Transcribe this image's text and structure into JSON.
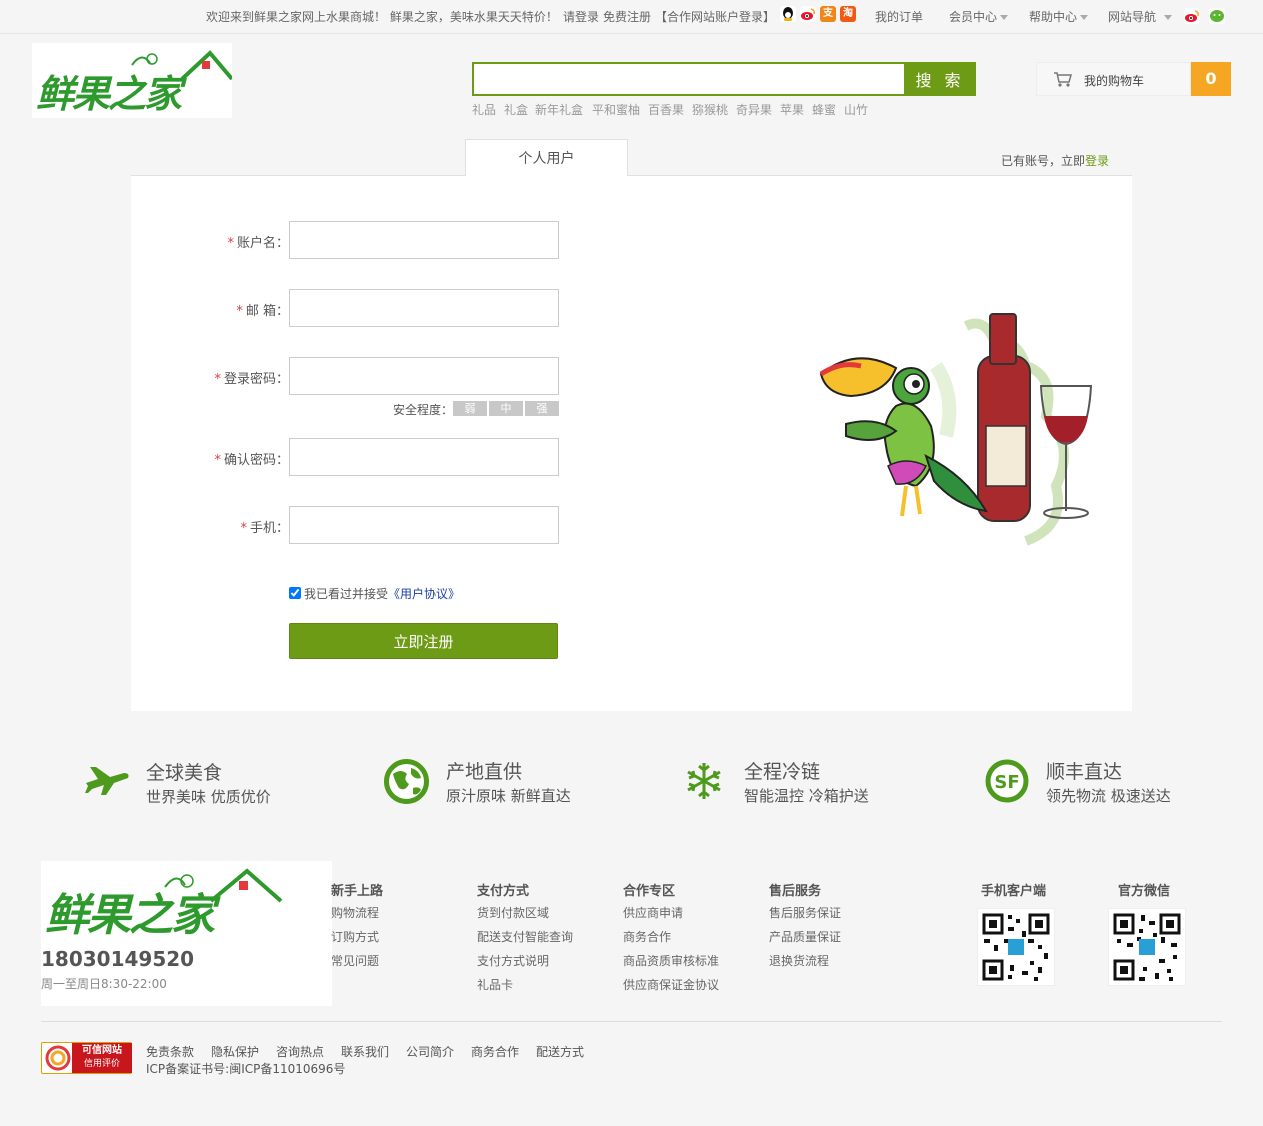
{
  "topbar": {
    "welcome": "欢迎来到鲜果之家网上水果商城！ 鲜果之家，美味水果天天特价！",
    "login": "请登录",
    "register": "免费注册",
    "partner_login": "【合作网站账户登录】",
    "my_orders": "我的订单",
    "member_center": "会员中心",
    "help_center": "帮助中心",
    "site_nav": "网站导航",
    "social_icons": [
      "qq-icon",
      "weibo-icon",
      "alipay-icon",
      "taobao-icon"
    ],
    "right_icons": [
      "weibo-icon",
      "wechat-icon"
    ]
  },
  "logo": {
    "text": "鲜果之家"
  },
  "search": {
    "placeholder": "",
    "button": "搜 索",
    "hot_keywords": [
      "礼品",
      "礼盒",
      "新年礼盒",
      "平和蜜柚",
      "百香果",
      "猕猴桃",
      "奇异果",
      "苹果",
      "蜂蜜",
      "山竹"
    ]
  },
  "cart": {
    "label": "我的购物车",
    "count": "0"
  },
  "register_tabs": {
    "active_tab": "个人用户",
    "has_account": "已有账号，立即",
    "login_link": "登录"
  },
  "form": {
    "star": "*",
    "username_label": "账户名：",
    "email_label": "邮 箱：",
    "password_label": "登录密码：",
    "strength_label": "安全程度：",
    "strength_levels": [
      "弱",
      "中",
      "强"
    ],
    "confirm_label": "确认密码：",
    "phone_label": "手机：",
    "agree_text": "我已看过并接受",
    "agreement_link": "《用户协议》",
    "agree_checked": true,
    "submit": "立即注册"
  },
  "features": [
    {
      "title": "全球美食",
      "subtitle": "世界美味 优质优价",
      "icon": "airplane-icon"
    },
    {
      "title": "产地直供",
      "subtitle": "原汁原味 新鲜直达",
      "icon": "globe-icon"
    },
    {
      "title": "全程冷链",
      "subtitle": "智能温控 冷箱护送",
      "icon": "snowflake-icon"
    },
    {
      "title": "顺丰直达",
      "subtitle": "领先物流 极速送达",
      "icon": "sf-express-icon"
    }
  ],
  "footer": {
    "phone": "18030149520",
    "hours": "周一至周日8:30-22:00",
    "columns": [
      {
        "title": "新手上路",
        "items": [
          "购物流程",
          "订购方式",
          "常见问题"
        ]
      },
      {
        "title": "支付方式",
        "items": [
          "货到付款区域",
          "配送支付智能查询",
          "支付方式说明",
          "礼品卡"
        ]
      },
      {
        "title": "合作专区",
        "items": [
          "供应商申请",
          "商务合作",
          "商品资质审核标准",
          "供应商保证金协议"
        ]
      },
      {
        "title": "售后服务",
        "items": [
          "售后服务保证",
          "产品质量保证",
          "退换货流程"
        ]
      }
    ],
    "app_title": "手机客户端",
    "wechat_title": "官方微信",
    "badge_line1": "可信网站",
    "badge_line2": "信用评价",
    "bottom_links": [
      "免责条款",
      "隐私保护",
      "咨询热点",
      "联系我们",
      "公司简介",
      "商务合作",
      "配送方式"
    ],
    "icp": "ICP备案证书号:闽ICP备11010696号"
  },
  "colors": {
    "brand_green": "#6d9b15",
    "cart_orange": "#f5a623",
    "required_red": "#e4393c",
    "link_blue": "#1a3fa8"
  }
}
